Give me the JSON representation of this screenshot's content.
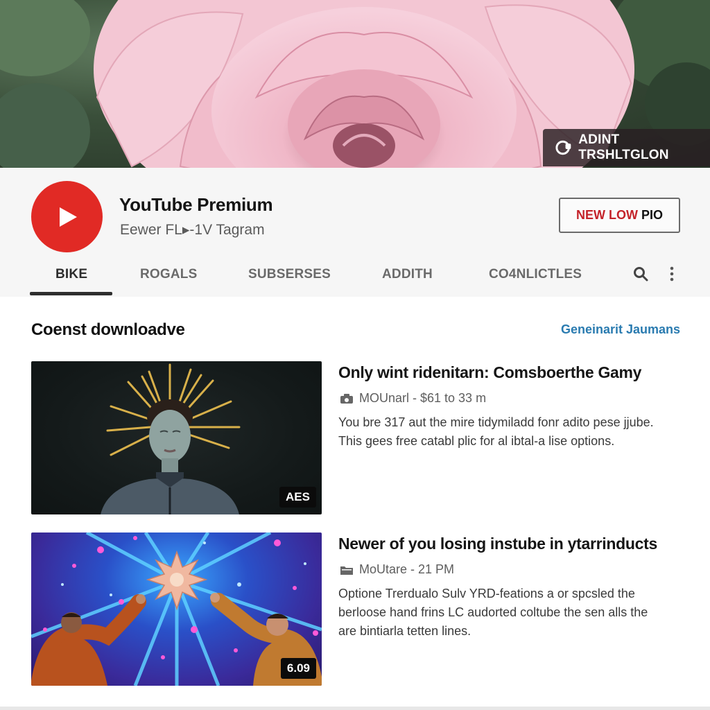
{
  "banner": {
    "badge_icon": "toggle-refresh-icon",
    "badge_label": "ADINT TRSHLTGLON"
  },
  "channel": {
    "avatar_icon": "youtube-play-icon",
    "name": "YouTube Premium",
    "subtitle": "Eewer FL▸-1V Tagram",
    "promo_button": {
      "label_red": "NEW LOW",
      "label_dark": "PIO",
      "accent_color": "#c4232a"
    },
    "brand_color": "#e12a25"
  },
  "tabs": {
    "items": [
      {
        "label": "BIKE",
        "active": true
      },
      {
        "label": "ROGALS",
        "active": false
      },
      {
        "label": "SUBSERSES",
        "active": false
      },
      {
        "label": "ADDITH",
        "active": false
      },
      {
        "label": "CO4NLICTLES",
        "active": false
      }
    ],
    "search_icon": "search-icon",
    "more_icon": "more-vertical-icon"
  },
  "section": {
    "title": "Coenst downloadve",
    "link": "Geneinarit Jaumans",
    "link_color": "#2a7bb0"
  },
  "videos": [
    {
      "thumbnail": "woman-with-spiky-golden-hair-on-dark-background",
      "duration": "AES",
      "title": "Only wint ridenitarn: Comsboerthe Gamy",
      "meta_icon": "camera-icon",
      "meta": "MOUnarl - $61 to 33 m",
      "description": [
        "You bre 317 aut the mire tidymiladd fonr adito pese jjube.",
        "This gees free catabl plic for al ibtal-a lise options."
      ]
    },
    {
      "thumbnail": "two-men-waving-under-cosmic-starburst",
      "duration": "6.09",
      "title": "Newer of you losing instube in ytarrinducts",
      "meta_icon": "folder-icon",
      "meta": "MoUtare - 21 PM",
      "description": [
        "Optione Trerdualo Sulv YRD-feations a or spcsled the",
        "berloose hand frins LC audorted coltube the sen alls the",
        "are bintiarla tetten lines."
      ]
    }
  ]
}
